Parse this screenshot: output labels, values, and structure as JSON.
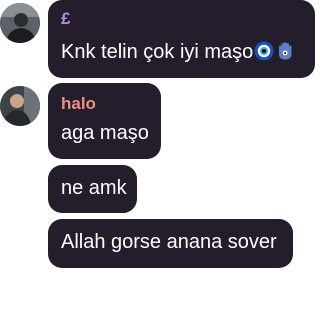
{
  "chat": {
    "messages": [
      {
        "author": "£",
        "author_color": "#b98ae6",
        "avatar_icon": "user-avatar-1",
        "text": "Knk telin çok iyi maşo",
        "emojis": [
          "nazar-amulet-icon",
          "hamsa-icon"
        ]
      },
      {
        "author": "halo",
        "author_color": "#ef8e86",
        "avatar_icon": "user-avatar-2",
        "text": "aga maşo"
      },
      {
        "text": "ne amk"
      },
      {
        "text": "Allah gorse anana sover"
      }
    ]
  },
  "colors": {
    "bubble_bg": "#241d2c",
    "message_text": "#ffffff"
  }
}
